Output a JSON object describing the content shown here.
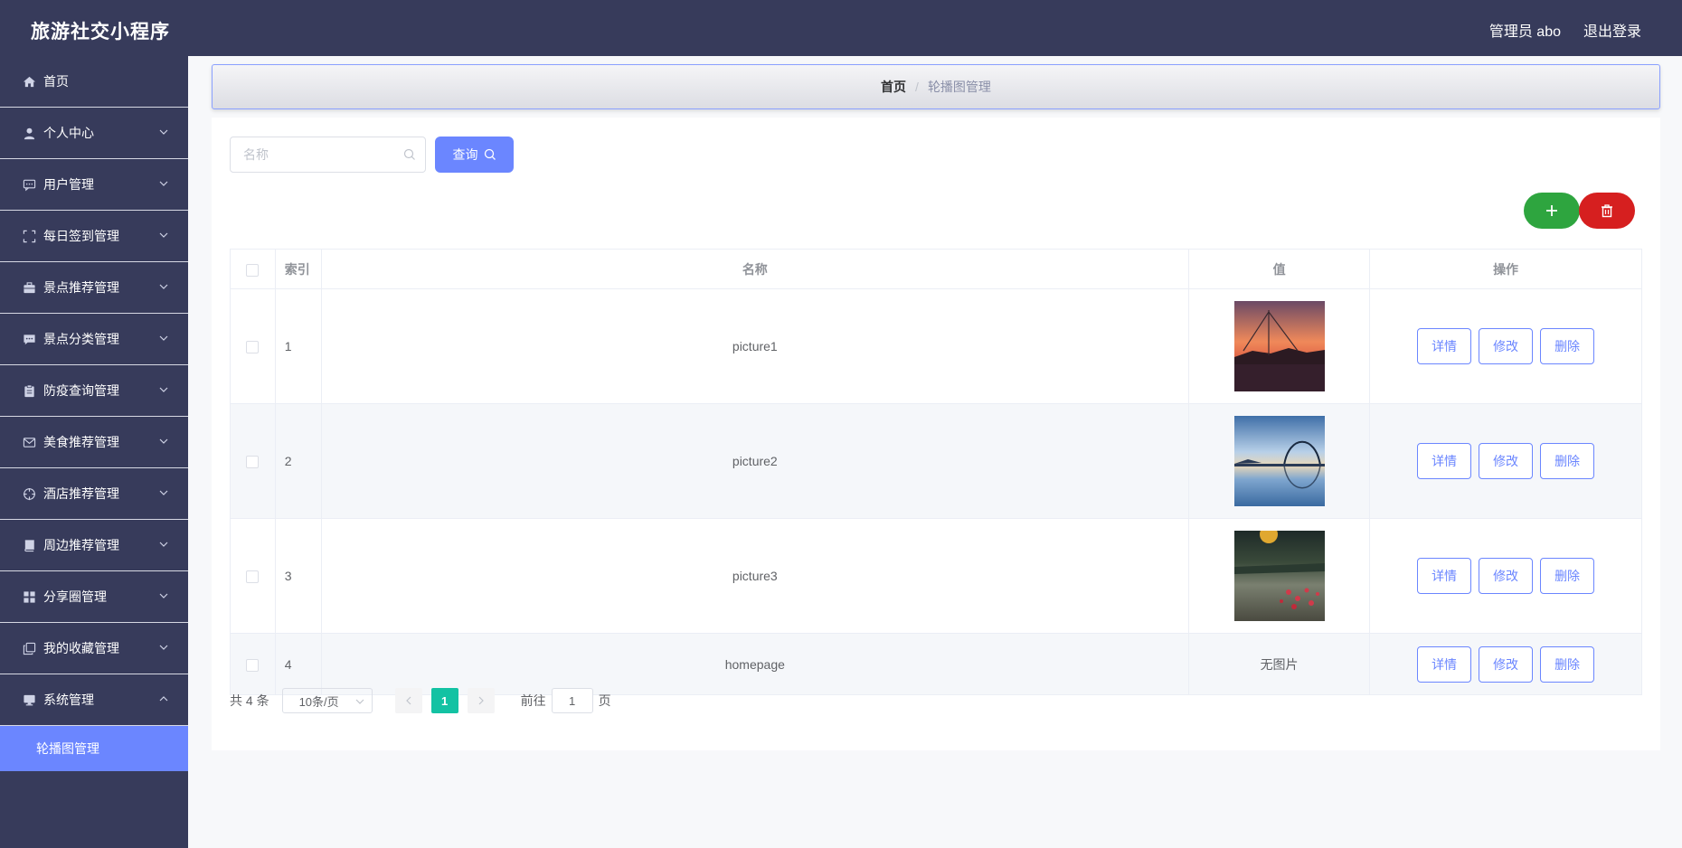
{
  "header": {
    "app_title": "旅游社交小程序",
    "admin_label": "管理员 abo",
    "logout_label": "退出登录"
  },
  "sidebar": {
    "items": [
      {
        "label": "首页",
        "icon": "home-icon",
        "expandable": false
      },
      {
        "label": "个人中心",
        "icon": "user-icon",
        "expandable": true
      },
      {
        "label": "用户管理",
        "icon": "chat-icon",
        "expandable": true
      },
      {
        "label": "每日签到管理",
        "icon": "fullscreen-icon",
        "expandable": true
      },
      {
        "label": "景点推荐管理",
        "icon": "suitcase-icon",
        "expandable": true
      },
      {
        "label": "景点分类管理",
        "icon": "message-icon",
        "expandable": true
      },
      {
        "label": "防疫查询管理",
        "icon": "clipboard-icon",
        "expandable": true
      },
      {
        "label": "美食推荐管理",
        "icon": "mail-icon",
        "expandable": true
      },
      {
        "label": "酒店推荐管理",
        "icon": "crosshair-icon",
        "expandable": true
      },
      {
        "label": "周边推荐管理",
        "icon": "book-icon",
        "expandable": true
      },
      {
        "label": "分享圈管理",
        "icon": "grid-icon",
        "expandable": true
      },
      {
        "label": "我的收藏管理",
        "icon": "copy-icon",
        "expandable": true
      },
      {
        "label": "系统管理",
        "icon": "monitor-icon",
        "expandable": true,
        "expanded": true
      }
    ],
    "active_sub_item": "轮播图管理"
  },
  "breadcrumb": {
    "home": "首页",
    "separator": "/",
    "current": "轮播图管理"
  },
  "search": {
    "placeholder": "名称",
    "value": "",
    "button_label": "查询"
  },
  "actions": {
    "add_icon": "plus-icon",
    "delete_icon": "trash-icon",
    "add_color": "#2ea53f",
    "delete_color": "#d61f1f"
  },
  "table": {
    "columns": [
      "",
      "索引",
      "名称",
      "值",
      "操作"
    ],
    "rows": [
      {
        "index": "1",
        "name": "picture1",
        "value": "image",
        "image": "sunset-bridge"
      },
      {
        "index": "2",
        "name": "picture2",
        "value": "image",
        "image": "arch-bridge-lake"
      },
      {
        "index": "3",
        "name": "picture3",
        "value": "image",
        "image": "flower-field"
      },
      {
        "index": "4",
        "name": "homepage",
        "value": "无图片",
        "image": null
      }
    ],
    "row_actions": {
      "detail": "详情",
      "edit": "修改",
      "delete": "删除"
    }
  },
  "pagination": {
    "total": "共 4 条",
    "page_size": "10条/页",
    "current_page": "1",
    "goto_label": "前往",
    "goto_value": "1",
    "page_suffix": "页"
  },
  "colors": {
    "sidebar_bg": "#373b5b",
    "accent": "#6b86ff",
    "page_active": "#13c2a3"
  }
}
